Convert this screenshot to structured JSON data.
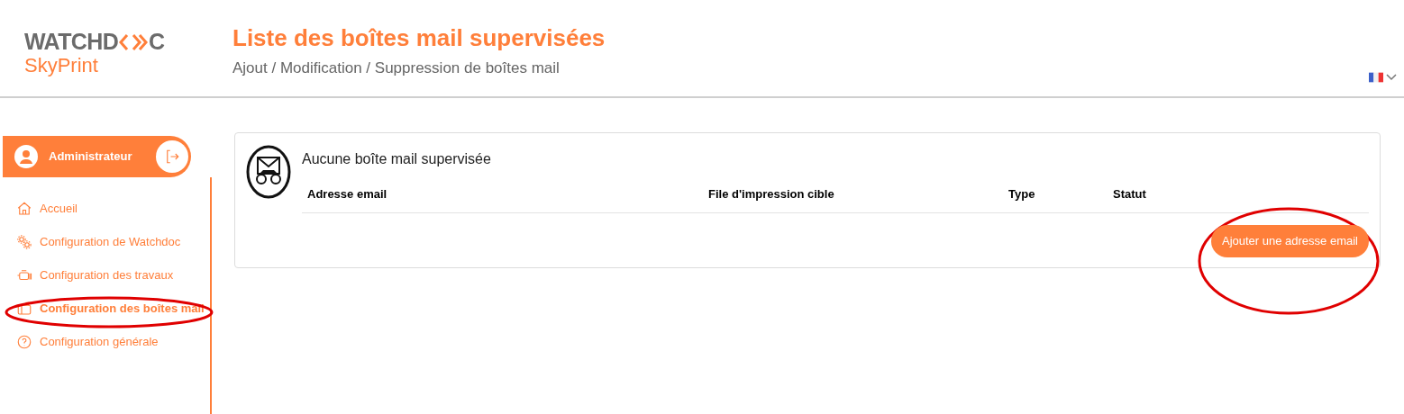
{
  "logo": {
    "text_start": "WATCHD",
    "text_end": "C",
    "subtitle": "SkyPrint"
  },
  "header": {
    "title": "Liste des boîtes mail supervisées",
    "subtitle": "Ajout / Modification / Suppression de boîtes mail"
  },
  "user": {
    "name": "Administrateur"
  },
  "sidebar": {
    "items": [
      {
        "label": "Accueil",
        "kind": "home",
        "selected": false,
        "highlighted": false
      },
      {
        "label": "Configuration de Watchdoc",
        "kind": "gears",
        "selected": false,
        "highlighted": false
      },
      {
        "label": "Configuration des travaux",
        "kind": "printer",
        "selected": false,
        "highlighted": false
      },
      {
        "label": "Configuration des boîtes mail",
        "kind": "mailbox",
        "selected": true,
        "highlighted": true
      },
      {
        "label": "Configuration générale",
        "kind": "help",
        "selected": false,
        "highlighted": false
      }
    ]
  },
  "panel": {
    "title": "Aucune boîte mail supervisée",
    "columns": [
      "Adresse email",
      "File d'impression cible",
      "Type",
      "Statut"
    ],
    "button": {
      "label": "Ajouter une adresse email",
      "highlighted": true
    }
  }
}
